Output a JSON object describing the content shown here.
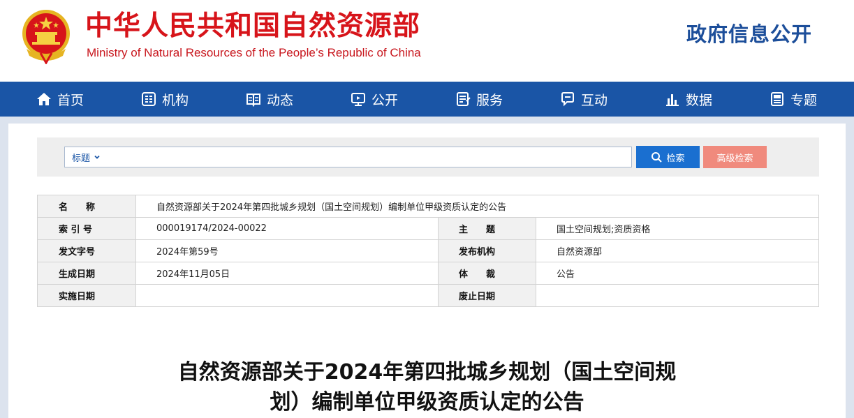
{
  "header": {
    "title": "中华人民共和国自然资源部",
    "subtitle": "Ministry of Natural Resources of the People’s Republic of China",
    "gov_info": "政府信息公开",
    "brand_red": "#d7141a",
    "brand_blue": "#1c4e9a"
  },
  "nav": {
    "bg": "#1a55a6",
    "items": [
      {
        "label": "首页",
        "icon": "home-icon"
      },
      {
        "label": "机构",
        "icon": "org-icon"
      },
      {
        "label": "动态",
        "icon": "book-icon"
      },
      {
        "label": "公开",
        "icon": "monitor-icon"
      },
      {
        "label": "服务",
        "icon": "document-icon"
      },
      {
        "label": "互动",
        "icon": "chat-icon"
      },
      {
        "label": "数据",
        "icon": "bar-chart-icon"
      },
      {
        "label": "专题",
        "icon": "topic-icon"
      }
    ]
  },
  "search": {
    "scope": "标题",
    "value": "",
    "button": "检索",
    "advanced": "高级检索"
  },
  "meta": {
    "name_label": "名　　称",
    "name_value": "自然资源部关于2024年第四批城乡规划（国土空间规划）编制单位甲级资质认定的公告",
    "index_label": "索 引 号",
    "index_value": "000019174/2024-00022",
    "topic_label": "主　　题",
    "topic_value": "国土空间规划;资质资格",
    "docno_label": "发文字号",
    "docno_value": "2024年第59号",
    "issuer_label": "发布机构",
    "issuer_value": "自然资源部",
    "created_label": "生成日期",
    "created_value": "2024年11月05日",
    "genre_label": "体　　裁",
    "genre_value": "公告",
    "effective_label": "实施日期",
    "effective_value": "",
    "expiry_label": "废止日期",
    "expiry_value": ""
  },
  "document": {
    "title_line1": "自然资源部关于2024年第四批城乡规划（国土空间规",
    "title_line2": "划）编制单位甲级资质认定的公告"
  }
}
